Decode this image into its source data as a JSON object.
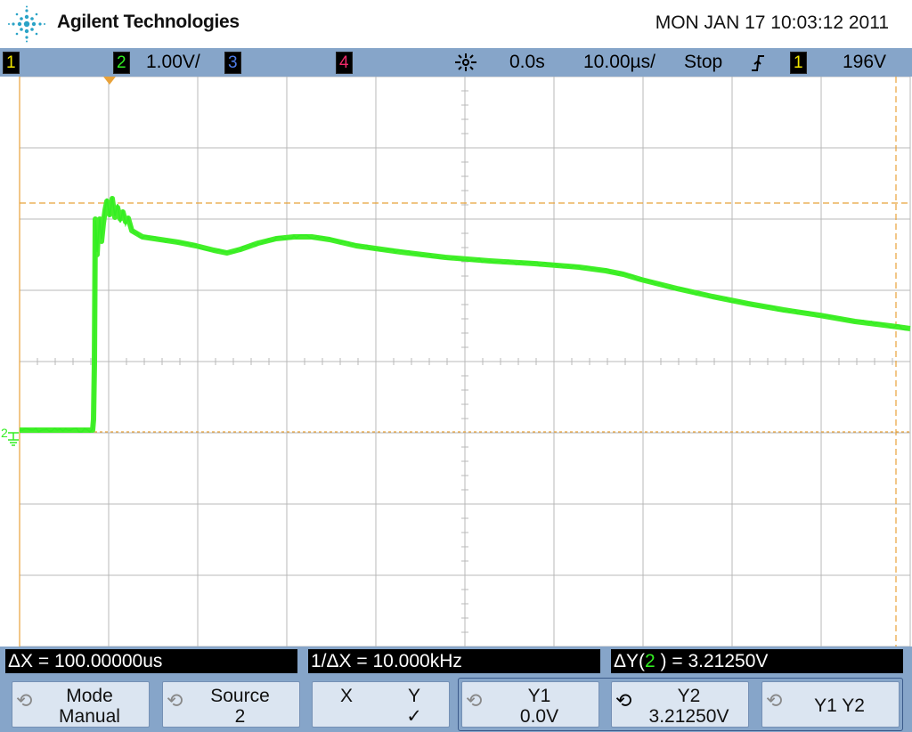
{
  "header": {
    "brand": "Agilent Technologies",
    "datetime": "MON JAN 17 10:03:12 2011"
  },
  "status": {
    "ch1": "1",
    "ch2": "2",
    "ch2_scale": "1.00V/",
    "ch3": "3",
    "ch4": "4",
    "delay": "0.0s",
    "timebase": "10.00µs/",
    "run_state": "Stop",
    "trig_source": "1",
    "trig_level": "196V"
  },
  "screen": {
    "ground_marker": "2"
  },
  "measure": {
    "dx": "ΔX = 100.00000us",
    "inv_dx": "1/ΔX = 10.000kHz",
    "dy_prefix": "ΔY(",
    "dy_ch": "2",
    "dy_suffix": " ) = 3.21250V"
  },
  "softkeys": {
    "mode_title": "Mode",
    "mode_value": "Manual",
    "source_title": "Source",
    "source_value": "2",
    "x_label": "X",
    "y_label": "Y",
    "y_check": "✓",
    "y1_title": "Y1",
    "y1_value": "0.0V",
    "y2_title": "Y2",
    "y2_value": "3.21250V",
    "y1y2_label": "Y1 Y2"
  },
  "colors": {
    "ch1": "#f2e600",
    "ch2": "#33ee22",
    "ch3": "#4e7ce8",
    "ch4": "#f02a6a",
    "cursor": "#e8a23a",
    "grid": "#b8b8b8",
    "bar": "#86a5c9"
  }
}
